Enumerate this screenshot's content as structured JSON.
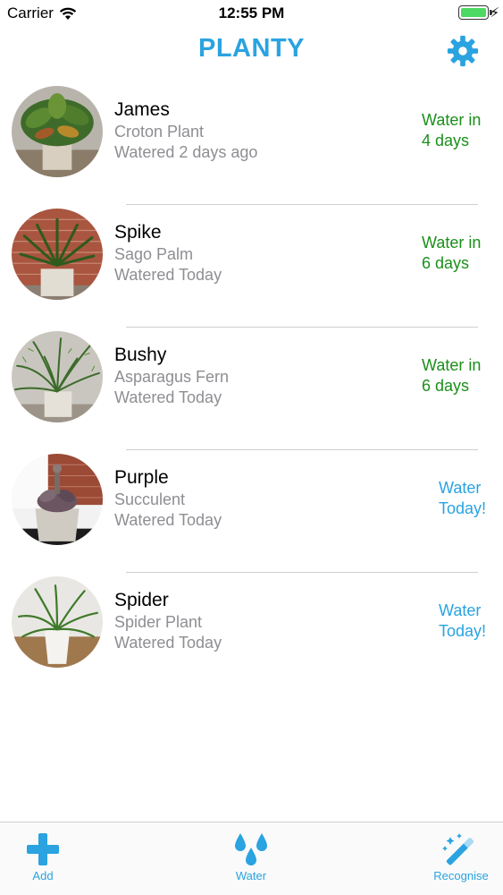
{
  "status_bar": {
    "carrier": "Carrier",
    "time": "12:55 PM"
  },
  "nav": {
    "title": "PLANTY",
    "settings_icon": "gear-icon"
  },
  "plants": [
    {
      "name": "James",
      "species": "Croton Plant",
      "watered": "Watered 2 days ago",
      "status_line1": "Water in",
      "status_line2": "4 days"
    },
    {
      "name": "Spike",
      "species": "Sago Palm",
      "watered": "Watered Today",
      "status_line1": "Water in",
      "status_line2": "6 days"
    },
    {
      "name": "Bushy",
      "species": "Asparagus Fern",
      "watered": "Watered Today",
      "status_line1": "Water in",
      "status_line2": "6 days"
    },
    {
      "name": "Purple",
      "species": "Succulent",
      "watered": "Watered Today",
      "status_line1": "Water",
      "status_line2": "Today!"
    },
    {
      "name": "Spider",
      "species": "Spider Plant",
      "watered": "Watered Today",
      "status_line1": "Water",
      "status_line2": "Today!"
    }
  ],
  "tab_bar": {
    "add_label": "Add",
    "water_label": "Water",
    "recognise_label": "Recognise"
  },
  "colors": {
    "accent": "#2aa3e0",
    "due_later": "#1a8f1a",
    "due_today": "#2aa3e0",
    "secondary_text": "#8e8e93"
  }
}
